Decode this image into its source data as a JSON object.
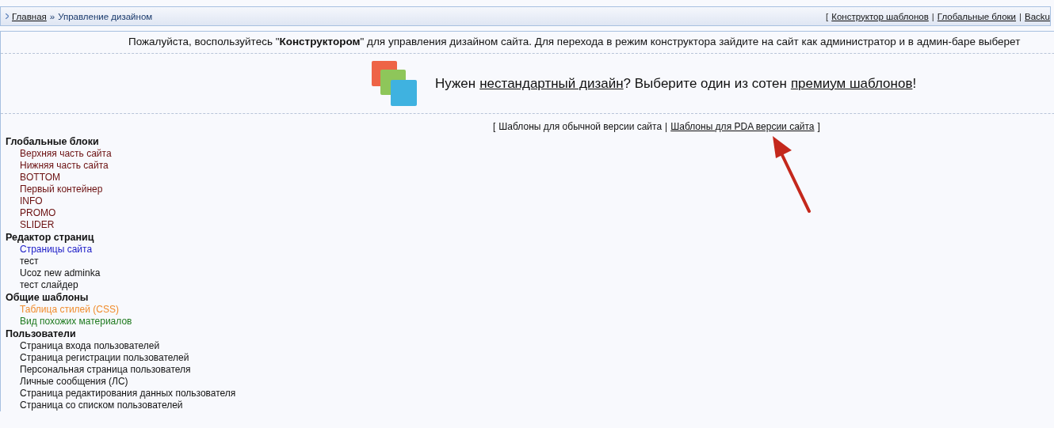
{
  "breadcrumbs": {
    "home": "Главная",
    "separator": "»",
    "current": "Управление дизайном"
  },
  "top_links": {
    "open": "[",
    "links": [
      "Конструктор шаблонов",
      "Глобальные блоки",
      "Backu"
    ],
    "divider": "|"
  },
  "notice": {
    "text": "Пожалуйста, воспользуйтесь \"**Конструктором**\" для управления дизайном сайта. Для перехода в режим конструктора зайдите на сайт как администратор и в админ-баре выберет"
  },
  "promo": {
    "before": "Нужен",
    "link_1": "нестандартный дизайн",
    "middle": "? Выберите один из сотен",
    "link_2": "премиум шаблонов",
    "after": "!"
  },
  "template_switch": {
    "open": "[",
    "current": "Шаблоны для обычной версии сайта",
    "divider": "|",
    "link": "Шаблоны для PDA версии сайта",
    "close": "]"
  },
  "groups": [
    {
      "title": "Глобальные блоки",
      "items": [
        {
          "label": "Верхняя часть сайта",
          "color": "#6b1010"
        },
        {
          "label": "Нижняя часть сайта",
          "color": "#6b1010"
        },
        {
          "label": "BOTTOM",
          "color": "#6b1010"
        },
        {
          "label": "Первый контейнер",
          "color": "#6b1010"
        },
        {
          "label": "INFO",
          "color": "#6b1010"
        },
        {
          "label": "PROMO",
          "color": "#6b1010"
        },
        {
          "label": "SLIDER",
          "color": "#6b1010"
        }
      ]
    },
    {
      "title": "Редактор страниц",
      "items": [
        {
          "label": "Страницы сайта",
          "color": "#2020c8"
        },
        {
          "label": "тест",
          "color": "#111111"
        },
        {
          "label": "Ucoz new adminka",
          "color": "#111111"
        },
        {
          "label": "тест слайдер",
          "color": "#111111"
        }
      ]
    },
    {
      "title": "Общие шаблоны",
      "items": [
        {
          "label": "Таблица стилей (CSS)",
          "color": "#f08c2c"
        },
        {
          "label": "Вид похожих материалов",
          "color": "#1f7a1f"
        }
      ]
    },
    {
      "title": "Пользователи",
      "items": [
        {
          "label": "Страница входа пользователей",
          "color": "#111111"
        },
        {
          "label": "Страница регистрации пользователей",
          "color": "#111111"
        },
        {
          "label": "Персональная страница пользователя",
          "color": "#111111"
        },
        {
          "label": "Личные сообщения (ЛС)",
          "color": "#111111"
        },
        {
          "label": "Страница редактирования данных пользователя",
          "color": "#111111"
        },
        {
          "label": "Страница со списком пользователей",
          "color": "#111111"
        }
      ]
    }
  ]
}
